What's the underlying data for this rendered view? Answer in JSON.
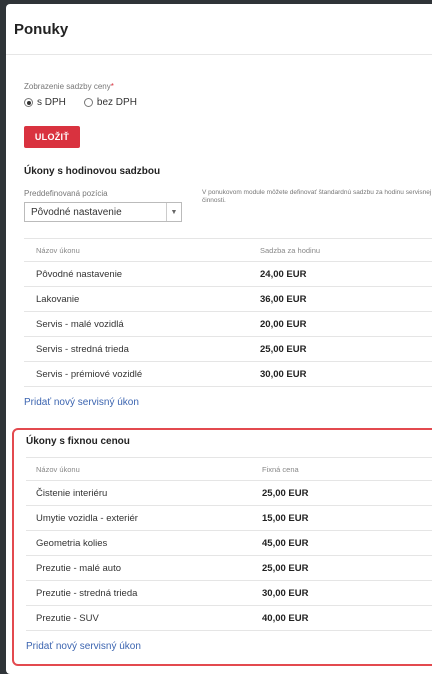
{
  "panel": {
    "title": "Ponuky"
  },
  "rate_display": {
    "label": "Zobrazenie sadzby ceny",
    "required_mark": "*",
    "options": [
      "s DPH",
      "bez DPH"
    ],
    "selected": "s DPH"
  },
  "save_button": "ULOŽIŤ",
  "hourly_section": {
    "title": "Úkony s hodinovou sadzbou",
    "predefined_label": "Preddefinovaná pozícia",
    "predefined_value": "Pôvodné nastavenie",
    "note": "V ponukovom module môžete definovať štandardnú sadzbu za hodinu servisnej činnosti.",
    "columns": [
      "Názov úkonu",
      "Sadzba za hodinu"
    ],
    "rows": [
      {
        "name": "Pôvodné nastavenie",
        "value": "24,00 EUR"
      },
      {
        "name": "Lakovanie",
        "value": "36,00 EUR"
      },
      {
        "name": "Servis - malé vozidlá",
        "value": "20,00 EUR"
      },
      {
        "name": "Servis - stredná trieda",
        "value": "25,00 EUR"
      },
      {
        "name": "Servis - prémiové vozidlé",
        "value": "30,00 EUR"
      }
    ],
    "add_link": "Pridať nový servisný úkon"
  },
  "fixed_section": {
    "title": "Úkony s fixnou cenou",
    "columns": [
      "Názov úkonu",
      "Fixná cena"
    ],
    "rows": [
      {
        "name": "Čistenie interiéru",
        "value": "25,00 EUR"
      },
      {
        "name": "Umytie vozidla - exteriér",
        "value": "15,00 EUR"
      },
      {
        "name": "Geometria kolies",
        "value": "45,00 EUR"
      },
      {
        "name": "Prezutie - malé auto",
        "value": "25,00 EUR"
      },
      {
        "name": "Prezutie - stredná trieda",
        "value": "30,00 EUR"
      },
      {
        "name": "Prezutie - SUV",
        "value": "40,00 EUR"
      }
    ],
    "add_link": "Pridať nový servisný úkon"
  },
  "colors": {
    "accent_red": "#d9323f",
    "highlight_border": "#e34a4f",
    "link_blue": "#3b64b0"
  }
}
